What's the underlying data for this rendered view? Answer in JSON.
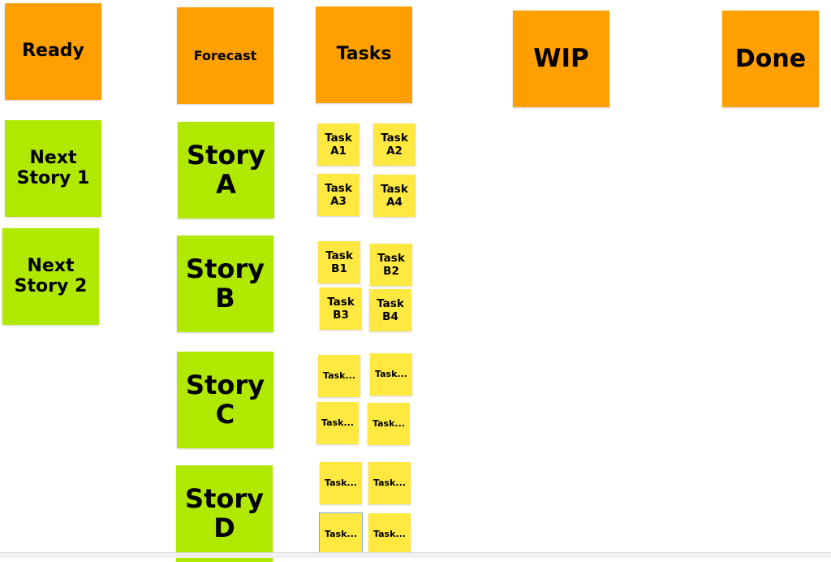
{
  "colors": {
    "header": "#ff9f00",
    "story": "#b0e800",
    "task": "#ffe83f",
    "selection": "#7aa7e6"
  },
  "headers": {
    "ready": "Ready",
    "forecast": "Forecast",
    "tasks": "Tasks",
    "wip": "WIP",
    "done": "Done"
  },
  "ready_stories": [
    "Next\nStory 1",
    "Next\nStory 2"
  ],
  "stories": [
    "Story\nA",
    "Story\nB",
    "Story\nC",
    "Story\nD"
  ],
  "tasks": {
    "a": [
      "Task\nA1",
      "Task\nA2",
      "Task\nA3",
      "Task\nA4"
    ],
    "b": [
      "Task\nB1",
      "Task\nB2",
      "Task\nB3",
      "Task\nB4"
    ],
    "c": [
      "Task...",
      "Task...",
      "Task...",
      "Task..."
    ],
    "d": [
      "Task...",
      "Task...",
      "Task...",
      "Task..."
    ]
  }
}
